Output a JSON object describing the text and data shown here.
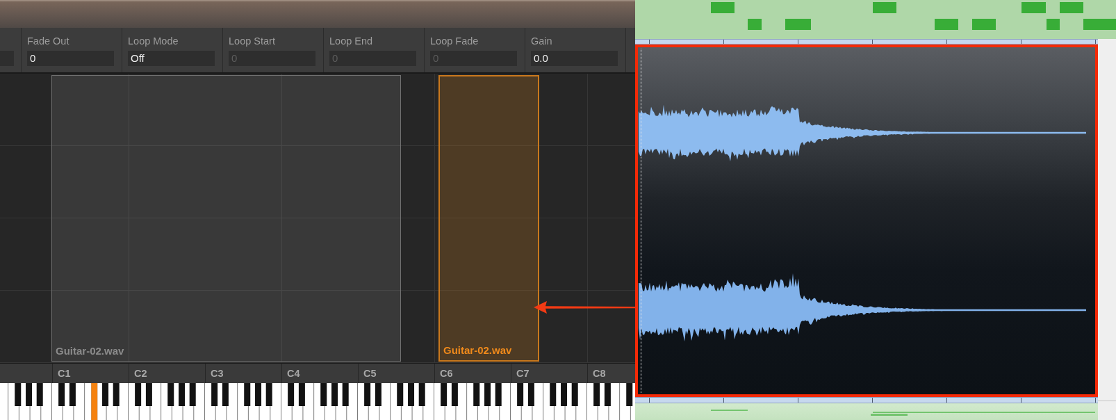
{
  "parameters": [
    {
      "label": "Fade Out",
      "value": "0",
      "disabled": false
    },
    {
      "label": "Loop Mode",
      "value": "Off",
      "disabled": false
    },
    {
      "label": "Loop Start",
      "value": "0",
      "disabled": true
    },
    {
      "label": "Loop End",
      "value": "0",
      "disabled": true
    },
    {
      "label": "Loop Fade",
      "value": "0",
      "disabled": true
    },
    {
      "label": "Gain",
      "value": "0.0",
      "disabled": false
    }
  ],
  "zones": [
    {
      "name": "Guitar-02.wav",
      "selected": false
    },
    {
      "name": "Guitar-02.wav",
      "selected": true
    }
  ],
  "keyboard": {
    "octave_labels": [
      "C1",
      "C2",
      "C3",
      "C4",
      "C5",
      "C6",
      "C7",
      "C8"
    ],
    "keys": [
      {
        "kind": "white",
        "selected": false
      },
      {
        "kind": "white",
        "selected": false
      },
      {
        "kind": "black",
        "selected": false
      },
      {
        "kind": "white",
        "selected": false
      },
      {
        "kind": "black",
        "selected": false
      },
      {
        "kind": "white",
        "selected": false
      },
      {
        "kind": "black",
        "selected": false
      },
      {
        "kind": "white",
        "selected": false
      },
      {
        "kind": "white",
        "selected": false
      },
      {
        "kind": "black",
        "selected": false
      },
      {
        "kind": "white",
        "selected": false
      },
      {
        "kind": "black",
        "selected": false
      },
      {
        "kind": "white",
        "selected": false
      },
      {
        "kind": "white",
        "selected": false
      },
      {
        "kind": "black",
        "selected": true
      },
      {
        "kind": "white",
        "selected": false
      },
      {
        "kind": "black",
        "selected": false
      },
      {
        "kind": "white",
        "selected": false
      },
      {
        "kind": "black",
        "selected": false
      },
      {
        "kind": "white",
        "selected": false
      },
      {
        "kind": "white",
        "selected": false
      },
      {
        "kind": "black",
        "selected": false
      },
      {
        "kind": "white",
        "selected": false
      },
      {
        "kind": "black",
        "selected": false
      },
      {
        "kind": "white",
        "selected": false
      },
      {
        "kind": "white",
        "selected": false
      },
      {
        "kind": "black",
        "selected": false
      },
      {
        "kind": "white",
        "selected": false
      },
      {
        "kind": "black",
        "selected": false
      },
      {
        "kind": "white",
        "selected": false
      },
      {
        "kind": "black",
        "selected": false
      },
      {
        "kind": "white",
        "selected": false
      },
      {
        "kind": "white",
        "selected": false
      },
      {
        "kind": "black",
        "selected": false
      },
      {
        "kind": "white",
        "selected": false
      },
      {
        "kind": "black",
        "selected": false
      },
      {
        "kind": "white",
        "selected": false
      },
      {
        "kind": "white",
        "selected": false
      },
      {
        "kind": "black",
        "selected": false
      },
      {
        "kind": "white",
        "selected": false
      },
      {
        "kind": "black",
        "selected": false
      },
      {
        "kind": "white",
        "selected": false
      },
      {
        "kind": "black",
        "selected": false
      },
      {
        "kind": "white",
        "selected": false
      },
      {
        "kind": "white",
        "selected": false
      },
      {
        "kind": "black",
        "selected": false
      },
      {
        "kind": "white",
        "selected": false
      },
      {
        "kind": "black",
        "selected": false
      },
      {
        "kind": "white",
        "selected": false
      },
      {
        "kind": "white",
        "selected": false
      },
      {
        "kind": "black",
        "selected": false
      },
      {
        "kind": "white",
        "selected": false
      },
      {
        "kind": "black",
        "selected": false
      },
      {
        "kind": "white",
        "selected": false
      },
      {
        "kind": "black",
        "selected": false
      },
      {
        "kind": "white",
        "selected": false
      },
      {
        "kind": "white",
        "selected": false
      },
      {
        "kind": "black",
        "selected": false
      },
      {
        "kind": "white",
        "selected": false
      },
      {
        "kind": "black",
        "selected": false
      },
      {
        "kind": "white",
        "selected": false
      },
      {
        "kind": "white",
        "selected": false
      },
      {
        "kind": "black",
        "selected": false
      },
      {
        "kind": "white",
        "selected": false
      },
      {
        "kind": "black",
        "selected": false
      },
      {
        "kind": "white",
        "selected": false
      },
      {
        "kind": "black",
        "selected": false
      },
      {
        "kind": "white",
        "selected": false
      },
      {
        "kind": "white",
        "selected": false
      },
      {
        "kind": "black",
        "selected": false
      },
      {
        "kind": "white",
        "selected": false
      },
      {
        "kind": "black",
        "selected": false
      },
      {
        "kind": "white",
        "selected": false
      },
      {
        "kind": "white",
        "selected": false
      },
      {
        "kind": "black",
        "selected": false
      },
      {
        "kind": "white",
        "selected": false
      },
      {
        "kind": "black",
        "selected": false
      },
      {
        "kind": "white",
        "selected": false
      },
      {
        "kind": "black",
        "selected": false
      },
      {
        "kind": "white",
        "selected": false
      },
      {
        "kind": "white",
        "selected": false
      },
      {
        "kind": "black",
        "selected": false
      },
      {
        "kind": "white",
        "selected": false
      },
      {
        "kind": "black",
        "selected": false
      },
      {
        "kind": "white",
        "selected": false
      },
      {
        "kind": "white",
        "selected": false
      },
      {
        "kind": "black",
        "selected": false
      },
      {
        "kind": "white",
        "selected": false
      },
      {
        "kind": "black",
        "selected": false
      },
      {
        "kind": "white",
        "selected": false
      },
      {
        "kind": "black",
        "selected": false
      },
      {
        "kind": "white",
        "selected": false
      },
      {
        "kind": "white",
        "selected": false
      },
      {
        "kind": "black",
        "selected": false
      },
      {
        "kind": "white",
        "selected": false
      },
      {
        "kind": "black",
        "selected": false
      },
      {
        "kind": "white",
        "selected": false
      },
      {
        "kind": "white",
        "selected": false
      },
      {
        "kind": "black",
        "selected": false
      },
      {
        "kind": "white",
        "selected": false
      }
    ]
  }
}
